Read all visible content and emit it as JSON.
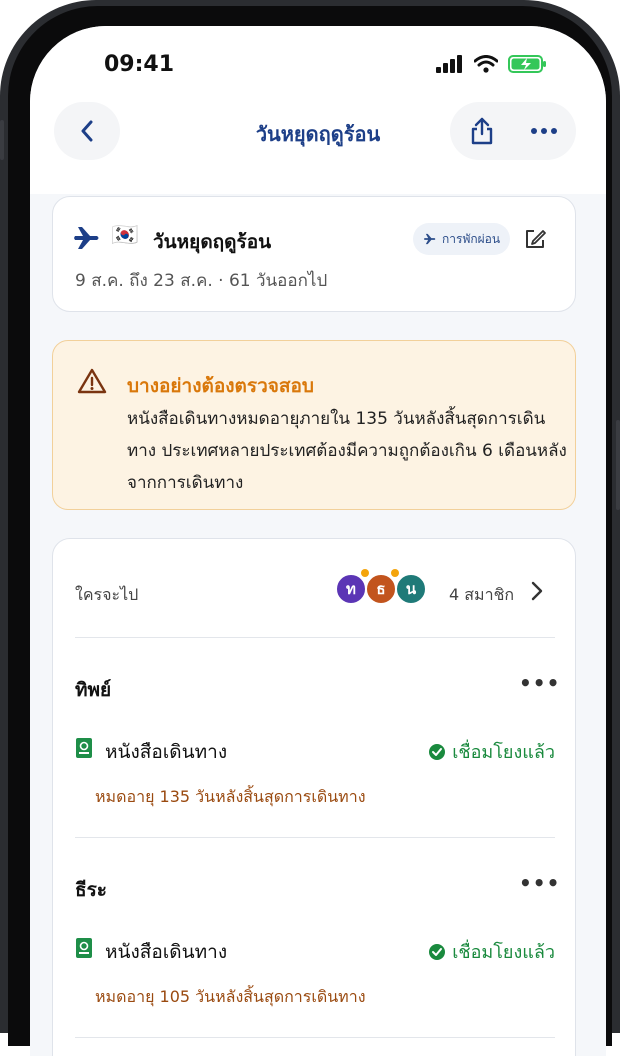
{
  "status": {
    "time": "09:41"
  },
  "nav": {
    "title": "วันหยุดฤดูร้อน"
  },
  "trip": {
    "title": "วันหยุดฤดูร้อน",
    "flag": "🇰🇷",
    "badge": "การพักผ่อน",
    "dates": "9 ส.ค. ถึง 23 ส.ค. · 61 วันออกไป"
  },
  "warning": {
    "title": "บางอย่างต้องตรวจสอบ",
    "body": "หนังสือเดินทางหมดอายุภายใน 135 วันหลังสิ้นสุดการเดินทาง ประเทศหลายประเทศต้องมีความถูกต้องเกิน 6 เดือนหลังจากการเดินทาง"
  },
  "members": {
    "label": "ใครจะไป",
    "count": "4 สมาชิก",
    "avatars": [
      {
        "initial": "ท",
        "color": "#5b35b5"
      },
      {
        "initial": "ธ",
        "color": "#c2541d"
      },
      {
        "initial": "น",
        "color": "#1f7a78"
      }
    ],
    "people": [
      {
        "name": "ทิพย์",
        "doc": "หนังสือเดินทาง",
        "status": "เชื่อมโยงแล้ว",
        "expiry": "หมดอายุ 135 วันหลังสิ้นสุดการเดินทาง"
      },
      {
        "name": "ธีระ",
        "doc": "หนังสือเดินทาง",
        "status": "เชื่อมโยงแล้ว",
        "expiry": "หมดอายุ 105 วันหลังสิ้นสุดการเดินทาง"
      }
    ]
  },
  "colors": {
    "accent": "#1d3f88",
    "warning": "#d9780b",
    "success": "#1a8a3e",
    "expiry": "#9a4a10"
  },
  "icons": [
    "back-chevron-icon",
    "share-icon",
    "more-icon",
    "airplane-icon",
    "edit-icon",
    "warning-triangle-icon",
    "chevron-right-icon",
    "passport-icon",
    "check-circle-icon"
  ]
}
